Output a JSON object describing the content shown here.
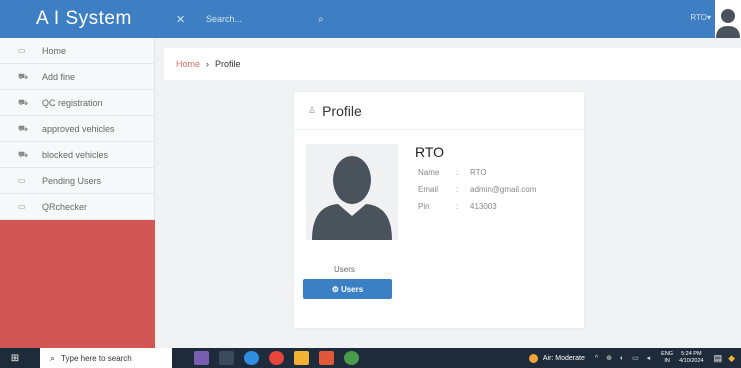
{
  "header": {
    "brand": "A I System",
    "menu_icon": "expand-icon",
    "search_placeholder": "Search...",
    "search_icon": "search-icon",
    "user_menu": "RTO"
  },
  "sidebar": {
    "items": [
      {
        "label": "Home",
        "icon": "home-icon"
      },
      {
        "label": "Add fine",
        "icon": "car-icon"
      },
      {
        "label": "QC registration",
        "icon": "car-icon"
      },
      {
        "label": "approved vehicles",
        "icon": "car-icon"
      },
      {
        "label": "blocked vehicles",
        "icon": "car-icon"
      },
      {
        "label": "Pending Users",
        "icon": "home-icon"
      },
      {
        "label": "QRchecker",
        "icon": "home-icon"
      }
    ],
    "accent_color": "#d25754"
  },
  "breadcrumb": {
    "home": "Home",
    "separator": "›",
    "current": "Profile"
  },
  "profile": {
    "title": "Profile",
    "name": "RTO",
    "fields": [
      {
        "key": "Name",
        "colon": ":",
        "value": "RTO"
      },
      {
        "key": "Email",
        "colon": ":",
        "value": "admin@gmail.com"
      },
      {
        "key": "Pin",
        "colon": ":",
        "value": "413003"
      }
    ],
    "users_label": "Users",
    "users_button": "Users"
  },
  "taskbar": {
    "search_placeholder": "Type here to search",
    "air_quality": "Air: Moderate",
    "lang_top": "ENG",
    "lang_bottom": "IN",
    "time": "5:24 PM",
    "date": "4/10/2024"
  },
  "colors": {
    "header": "#3d7fc2",
    "button": "#3b7fc4",
    "breadcrumb_link": "#e26a6a"
  }
}
